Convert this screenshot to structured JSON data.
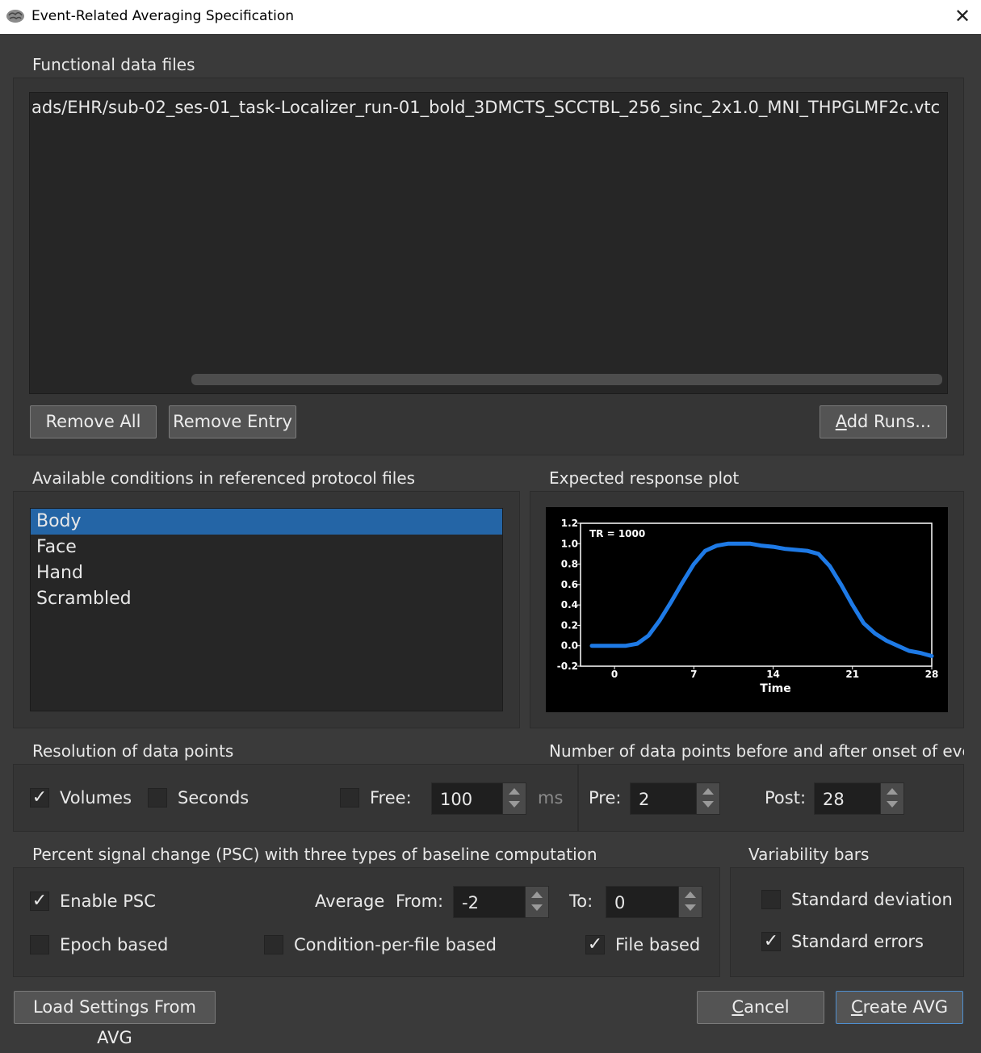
{
  "window": {
    "title": "Event-Related Averaging Specification",
    "close_icon": "close-icon",
    "app_icon": "brain-icon"
  },
  "functional": {
    "section_label": "Functional data files",
    "files": [
      "ads/EHR/sub-02_ses-01_task-Localizer_run-01_bold_3DMCTS_SCCTBL_256_sinc_2x1.0_MNI_THPGLMF2c.vtc"
    ],
    "remove_all": "Remove All",
    "remove_entry": "Remove Entry",
    "add_runs": "Add Runs..."
  },
  "conditions": {
    "section_label": "Available conditions in referenced protocol files",
    "items": [
      "Body",
      "Face",
      "Hand",
      "Scrambled"
    ],
    "selected_index": 0
  },
  "plot": {
    "section_label": "Expected response plot",
    "annotation": "TR = 1000"
  },
  "chart_data": {
    "type": "line",
    "title": "",
    "xlabel": "Time",
    "ylabel": "",
    "annotation": "TR = 1000",
    "xlim": [
      -3,
      28
    ],
    "ylim": [
      -0.2,
      1.2
    ],
    "xticks": [
      "0",
      "7",
      "14",
      "21",
      "28"
    ],
    "yticks": [
      "-0.2",
      "0.0",
      "0.2",
      "0.4",
      "0.6",
      "0.8",
      "1.0",
      "1.2"
    ],
    "x": [
      -2,
      -1,
      0,
      1,
      2,
      3,
      4,
      5,
      6,
      7,
      8,
      9,
      10,
      11,
      12,
      13,
      14,
      15,
      16,
      17,
      18,
      19,
      20,
      21,
      22,
      23,
      24,
      25,
      26,
      27,
      28
    ],
    "y": [
      0.0,
      0.0,
      0.0,
      0.0,
      0.02,
      0.1,
      0.25,
      0.43,
      0.62,
      0.8,
      0.93,
      0.98,
      1.0,
      1.0,
      1.0,
      0.98,
      0.97,
      0.95,
      0.94,
      0.93,
      0.9,
      0.78,
      0.6,
      0.4,
      0.22,
      0.12,
      0.05,
      0.0,
      -0.05,
      -0.07,
      -0.1
    ],
    "color": "#1e7ae6",
    "grid": false
  },
  "resolution": {
    "section_label": "Resolution of data points",
    "volumes_label": "Volumes",
    "volumes_checked": true,
    "seconds_label": "Seconds",
    "seconds_checked": false,
    "free_label": "Free:",
    "free_checked": false,
    "free_value": "100",
    "free_unit": "ms"
  },
  "points": {
    "section_label": "Number of data points before and after onset of ever",
    "pre_label": "Pre:",
    "pre_value": "2",
    "post_label": "Post:",
    "post_value": "28"
  },
  "psc": {
    "section_label": "Percent signal change (PSC) with three types of baseline computation",
    "enable_label": "Enable PSC",
    "enable_checked": true,
    "average_label": "Average",
    "from_label": "From:",
    "from_value": "-2",
    "to_label": "To:",
    "to_value": "0",
    "epoch_label": "Epoch based",
    "epoch_checked": false,
    "cond_label": "Condition-per-file based",
    "cond_checked": false,
    "file_label": "File based",
    "file_checked": true
  },
  "variability": {
    "section_label": "Variability bars",
    "sd_label": "Standard deviation",
    "sd_checked": false,
    "se_label": "Standard errors",
    "se_checked": true
  },
  "footer": {
    "load": "Load Settings From AVG",
    "cancel": "Cancel",
    "create": "Create AVG"
  },
  "colors": {
    "selection": "#2465a6",
    "accent": "#4f8fd0",
    "plot_line": "#1e7ae6"
  }
}
